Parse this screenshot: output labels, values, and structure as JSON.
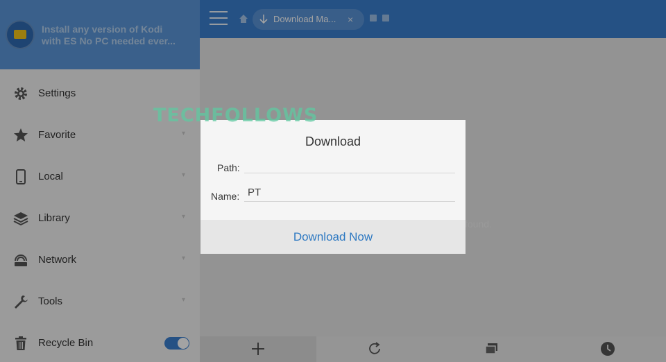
{
  "drawer": {
    "promo": {
      "line1": "Install any version of Kodi",
      "line2": "with ES No PC needed ever..."
    },
    "items": [
      {
        "label": "Settings",
        "icon": "gear-icon"
      },
      {
        "label": "Favorite",
        "icon": "star-icon"
      },
      {
        "label": "Local",
        "icon": "phone-icon"
      },
      {
        "label": "Library",
        "icon": "layers-icon"
      },
      {
        "label": "Network",
        "icon": "network-icon"
      },
      {
        "label": "Tools",
        "icon": "wrench-icon"
      },
      {
        "label": "Recycle Bin",
        "icon": "trash-icon"
      }
    ],
    "recycle_bin_toggle": "on"
  },
  "topbar": {
    "breadcrumb_label": "Download Ma...",
    "close_glyph": "×"
  },
  "content": {
    "empty_text": "found."
  },
  "bottom_toolbar": [
    "plus-icon",
    "refresh-icon",
    "windows-icon",
    "clock-icon"
  ],
  "dialog": {
    "title": "Download",
    "path_label": "Path:",
    "path_value": "",
    "name_label": "Name:",
    "name_value": "PT",
    "action_label": "Download Now"
  },
  "watermark": "TECHFOLLOWS",
  "colors": {
    "accent": "#3b7fcf",
    "action_text": "#2e79c2"
  }
}
